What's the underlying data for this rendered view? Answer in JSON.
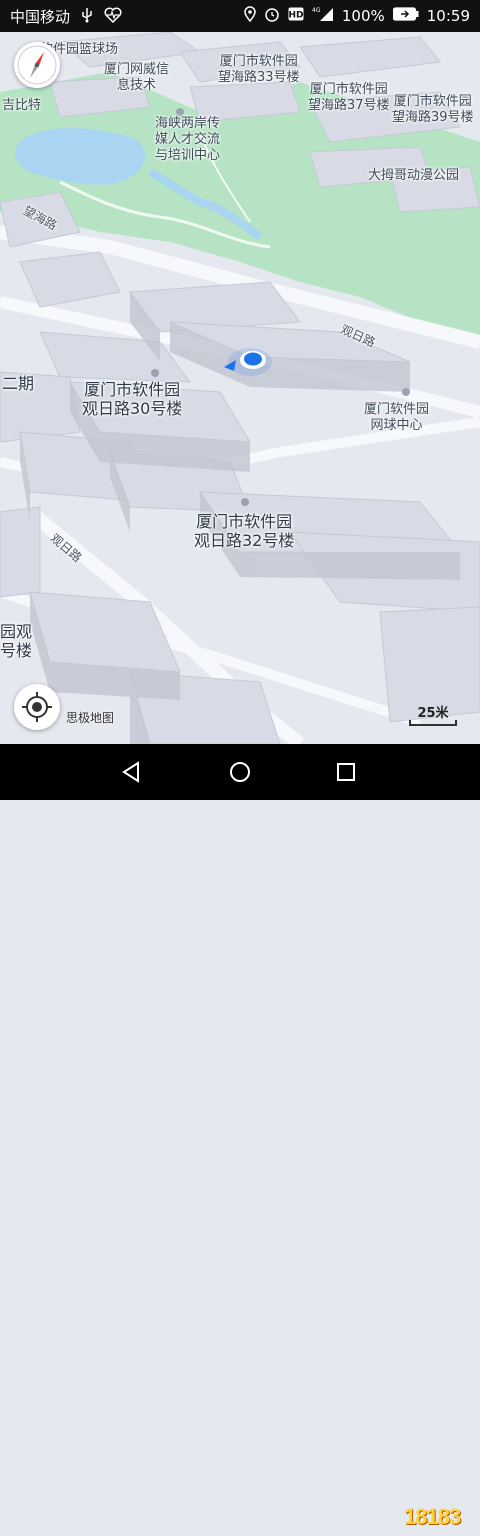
{
  "status_bar": {
    "carrier": "中国移动",
    "battery": "100%",
    "time": "10:59",
    "icons": [
      "usb-icon",
      "heart-rate-icon",
      "location-icon",
      "alarm-icon",
      "hd-icon",
      "signal-4g-icon",
      "battery-icon"
    ]
  },
  "map": {
    "labels": [
      {
        "id": "park-1",
        "text": "软件园篮球场"
      },
      {
        "id": "xm-weixin",
        "text": "厦门网威信\n息技术"
      },
      {
        "id": "xm-wanghai33",
        "text": "厦门市软件园\n望海路33号楼"
      },
      {
        "id": "xm-wanghai37",
        "text": "厦门市软件园\n望海路37号楼"
      },
      {
        "id": "xm-wanghai39",
        "text": "厦门市软件园\n望海路39号楼"
      },
      {
        "id": "jibite",
        "text": "吉比特"
      },
      {
        "id": "haixia",
        "text": "海峡两岸传\n媒人才交流\n与培训中心"
      },
      {
        "id": "damu",
        "text": "大拇哥动漫公园"
      },
      {
        "id": "road-wanghai",
        "text": "望海路"
      },
      {
        "id": "road-guanri",
        "text": "观日路"
      },
      {
        "id": "erqi",
        "text": "二期"
      },
      {
        "id": "xm-guanri30",
        "text": "厦门市软件园\n观日路30号楼"
      },
      {
        "id": "tennis",
        "text": "厦门软件园\n网球中心"
      },
      {
        "id": "xm-guanri32",
        "text": "厦门市软件园\n观日路32号楼"
      },
      {
        "id": "road-guanri-2",
        "text": "观日路"
      },
      {
        "id": "yuanguan",
        "text": "园观\n号楼"
      }
    ]
  },
  "controls": {
    "brand": "思极地图",
    "scale": "25米"
  },
  "watermark": {
    "text": "18183"
  },
  "colors": {
    "park": "#b5e3c4",
    "water": "#a9d4f2",
    "ground": "#e6e8ef",
    "building_top": "#d8dbe5",
    "building_side": "#c2c6d2",
    "location_dot": "#1a73e8"
  }
}
